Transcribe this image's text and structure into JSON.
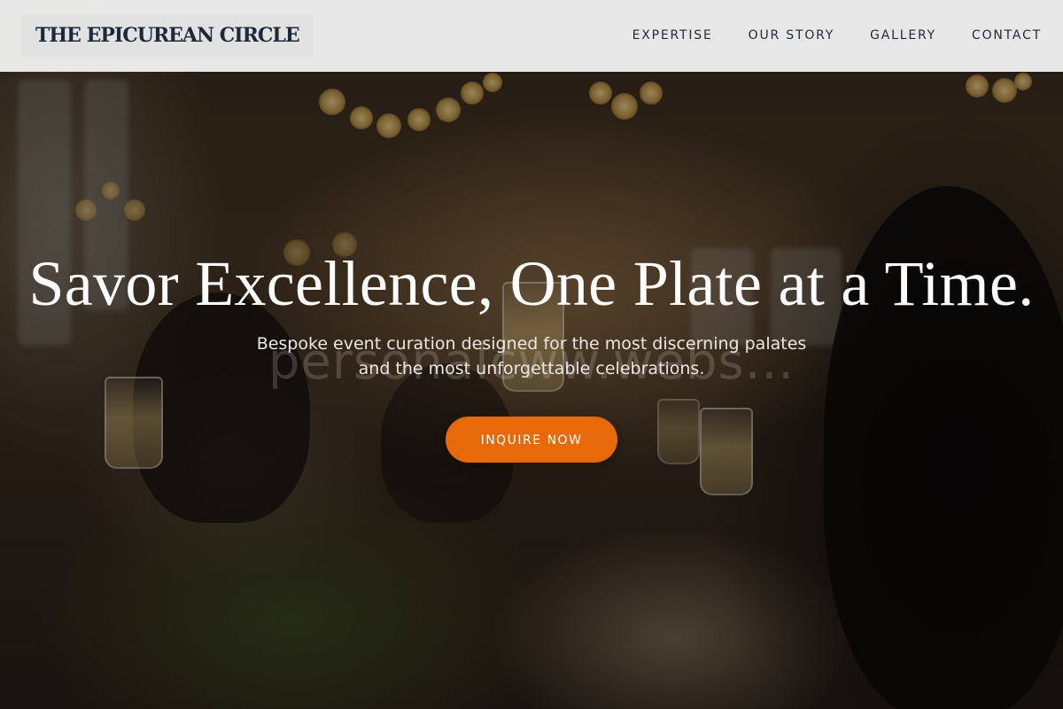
{
  "header": {
    "brand": "THE EPICUREAN CIRCLE",
    "nav": [
      {
        "label": "EXPERTISE"
      },
      {
        "label": "OUR STORY"
      },
      {
        "label": "GALLERY"
      },
      {
        "label": "CONTACT"
      }
    ]
  },
  "hero": {
    "title": "Savor Excellence, One Plate at a Time.",
    "subtitle_line1": "Bespoke event curation designed for the most discerning palates",
    "subtitle_line2": "and the most unforgettable celebrations.",
    "cta_label": "INQUIRE NOW",
    "watermark": "personalcww.webs...",
    "background": "celebration-dinner-photo"
  },
  "colors": {
    "accent": "#e8690a",
    "header_bg": "#f4f4f4",
    "brand_text": "#1e2a3a"
  }
}
